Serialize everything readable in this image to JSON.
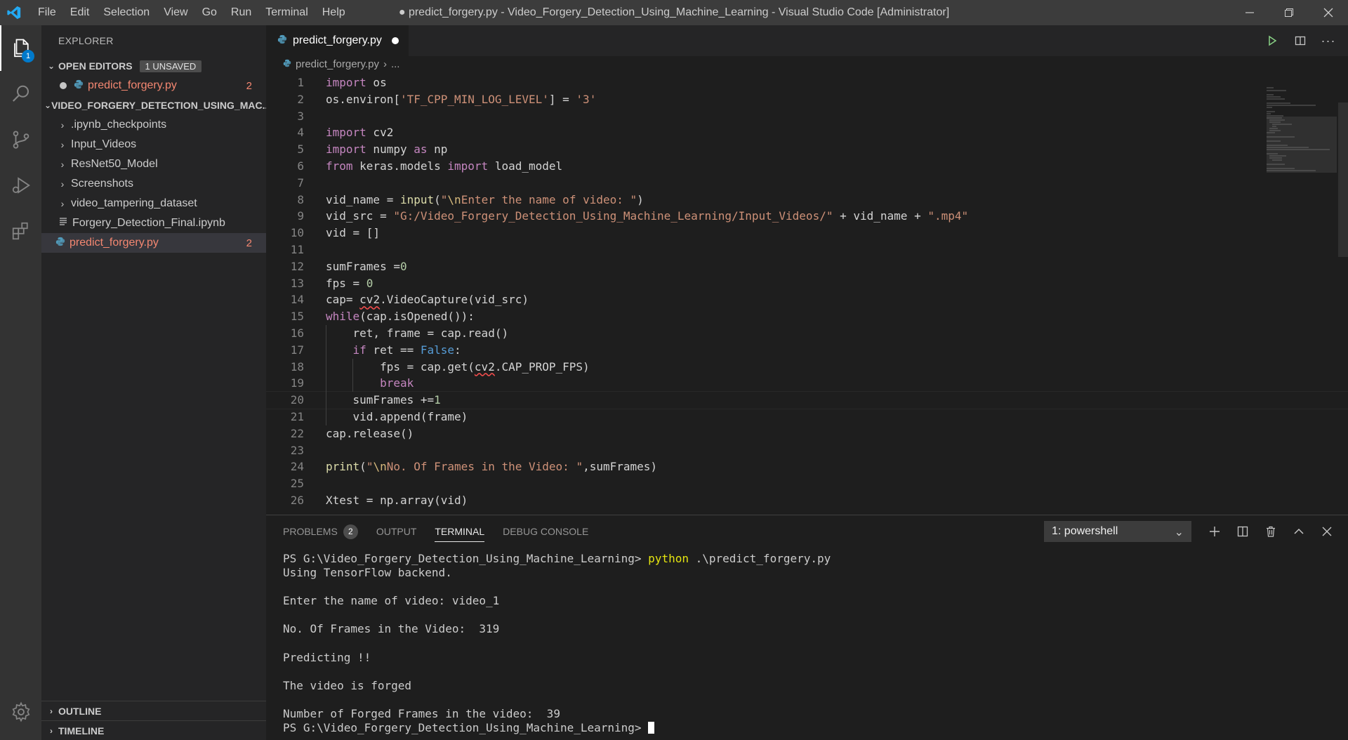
{
  "window": {
    "title": "● predict_forgery.py - Video_Forgery_Detection_Using_Machine_Learning - Visual Studio Code [Administrator]"
  },
  "menu": [
    "File",
    "Edit",
    "Selection",
    "View",
    "Go",
    "Run",
    "Terminal",
    "Help"
  ],
  "activity": {
    "explorer_badge": "1"
  },
  "sidebar": {
    "title": "EXPLORER",
    "open_editors": {
      "label": "OPEN EDITORS",
      "badge": "1 UNSAVED",
      "files": [
        {
          "name": "predict_forgery.py",
          "problems": "2"
        }
      ]
    },
    "folder": {
      "label": "VIDEO_FORGERY_DETECTION_USING_MAC...",
      "items": [
        {
          "name": ".ipynb_checkpoints",
          "type": "folder"
        },
        {
          "name": "Input_Videos",
          "type": "folder"
        },
        {
          "name": "ResNet50_Model",
          "type": "folder"
        },
        {
          "name": "Screenshots",
          "type": "folder"
        },
        {
          "name": "video_tampering_dataset",
          "type": "folder"
        },
        {
          "name": "Forgery_Detection_Final.ipynb",
          "type": "file"
        },
        {
          "name": "predict_forgery.py",
          "type": "python",
          "problems": "2"
        }
      ]
    },
    "outline_label": "OUTLINE",
    "timeline_label": "TIMELINE"
  },
  "editor": {
    "tab_label": "predict_forgery.py",
    "breadcrumb": {
      "file": "predict_forgery.py",
      "rest": "..."
    }
  },
  "code_lines": [
    [
      [
        "k",
        "import"
      ],
      [
        "p",
        " os"
      ]
    ],
    [
      [
        "p",
        "os.environ["
      ],
      [
        "s",
        "'TF_CPP_MIN_LOG_LEVEL'"
      ],
      [
        "p",
        "] = "
      ],
      [
        "s",
        "'3'"
      ]
    ],
    [],
    [
      [
        "k",
        "import"
      ],
      [
        "p",
        " cv2"
      ]
    ],
    [
      [
        "k",
        "import"
      ],
      [
        "p",
        " numpy "
      ],
      [
        "k",
        "as"
      ],
      [
        "p",
        " np"
      ]
    ],
    [
      [
        "k",
        "from"
      ],
      [
        "p",
        " keras.models "
      ],
      [
        "k",
        "import"
      ],
      [
        "p",
        " load_model"
      ]
    ],
    [],
    [
      [
        "p",
        "vid_name = "
      ],
      [
        "f",
        "input"
      ],
      [
        "p",
        "("
      ],
      [
        "s",
        "\""
      ],
      [
        "e",
        "\\n"
      ],
      [
        "s",
        "Enter the name of video: \""
      ],
      [
        "p",
        ")"
      ]
    ],
    [
      [
        "p",
        "vid_src = "
      ],
      [
        "s",
        "\"G:/Video_Forgery_Detection_Using_Machine_Learning/Input_Videos/\""
      ],
      [
        "p",
        " + vid_name + "
      ],
      [
        "s",
        "\".mp4\""
      ]
    ],
    [
      [
        "p",
        "vid = []"
      ]
    ],
    [],
    [
      [
        "p",
        "sumFrames ="
      ],
      [
        "n",
        "0"
      ]
    ],
    [
      [
        "p",
        "fps = "
      ],
      [
        "n",
        "0"
      ]
    ],
    [
      [
        "p",
        "cap= "
      ],
      [
        "q",
        "cv2"
      ],
      [
        "p",
        ".VideoCapture(vid_src)"
      ]
    ],
    [
      [
        "k",
        "while"
      ],
      [
        "p",
        "(cap.isOpened()):"
      ]
    ],
    [
      [
        "p",
        "    ret, frame = cap.read()"
      ]
    ],
    [
      [
        "p",
        "    "
      ],
      [
        "k",
        "if"
      ],
      [
        "p",
        " ret == "
      ],
      [
        "b",
        "False"
      ],
      [
        "p",
        ":"
      ]
    ],
    [
      [
        "p",
        "        fps = cap.get("
      ],
      [
        "q",
        "cv2"
      ],
      [
        "p",
        ".CAP_PROP_FPS)"
      ]
    ],
    [
      [
        "p",
        "        "
      ],
      [
        "k",
        "break"
      ]
    ],
    [
      [
        "p",
        "    sumFrames +="
      ],
      [
        "n",
        "1"
      ]
    ],
    [
      [
        "p",
        "    vid.append(frame)"
      ]
    ],
    [
      [
        "p",
        "cap.release()"
      ]
    ],
    [],
    [
      [
        "f",
        "print"
      ],
      [
        "p",
        "("
      ],
      [
        "s",
        "\""
      ],
      [
        "e",
        "\\n"
      ],
      [
        "s",
        "No. Of Frames in the Video: \""
      ],
      [
        "p",
        ",sumFrames)"
      ]
    ],
    [],
    [
      [
        "p",
        "Xtest = np.array(vid)"
      ]
    ]
  ],
  "panel": {
    "tabs": [
      {
        "label": "PROBLEMS",
        "badge": "2"
      },
      {
        "label": "OUTPUT"
      },
      {
        "label": "TERMINAL",
        "active": true
      },
      {
        "label": "DEBUG CONSOLE"
      }
    ],
    "terminal_select": "1: powershell"
  },
  "terminal": {
    "prompt": "PS G:\\Video_Forgery_Detection_Using_Machine_Learning> ",
    "command": "python",
    "command_args": " .\\predict_forgery.py",
    "lines": [
      "Using TensorFlow backend.",
      "",
      "Enter the name of video: video_1",
      "",
      "No. Of Frames in the Video:  319",
      "",
      "Predicting !!",
      "",
      "The video is forged",
      "",
      "Number of Forged Frames in the video:  39"
    ],
    "final_prompt": "PS G:\\Video_Forgery_Detection_Using_Machine_Learning> "
  },
  "colors": {
    "accent": "#007acc",
    "keyword": "#c586c0",
    "string": "#ce9178",
    "number": "#b5cea8",
    "error": "#f48771"
  }
}
